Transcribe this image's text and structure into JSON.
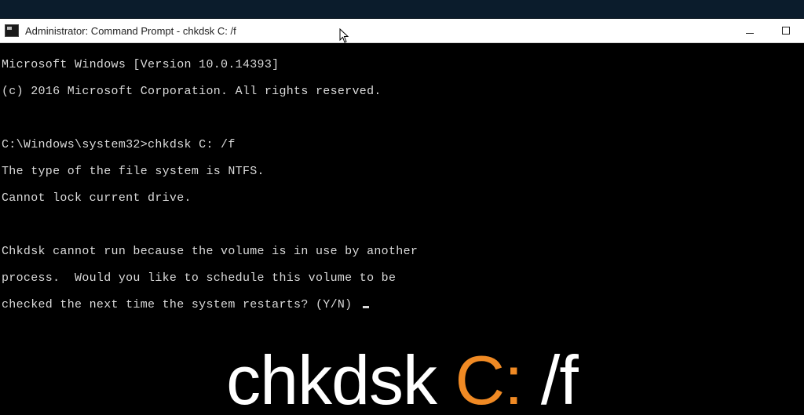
{
  "window": {
    "title": "Administrator: Command Prompt - chkdsk  C: /f"
  },
  "console": {
    "line_version": "Microsoft Windows [Version 10.0.14393]",
    "line_copyright": "(c) 2016 Microsoft Corporation. All rights reserved.",
    "prompt_path": "C:\\Windows\\system32>",
    "command": "chkdsk C: /f",
    "line_fs": "The type of the file system is NTFS.",
    "line_lock": "Cannot lock current drive.",
    "line_inuse": "Chkdsk cannot run because the volume is in use by another",
    "line_sched": "process.  Would you like to schedule this volume to be",
    "line_prompt_q": "checked the next time the system restarts? (Y/N) "
  },
  "caption": {
    "part1": "chkdsk ",
    "part2": "C:",
    "part3": " /f"
  },
  "colors": {
    "console_bg": "#000000",
    "console_fg": "#d9d9d9",
    "titlebar_bg": "#ffffff",
    "accent_orange": "#f08a24"
  }
}
